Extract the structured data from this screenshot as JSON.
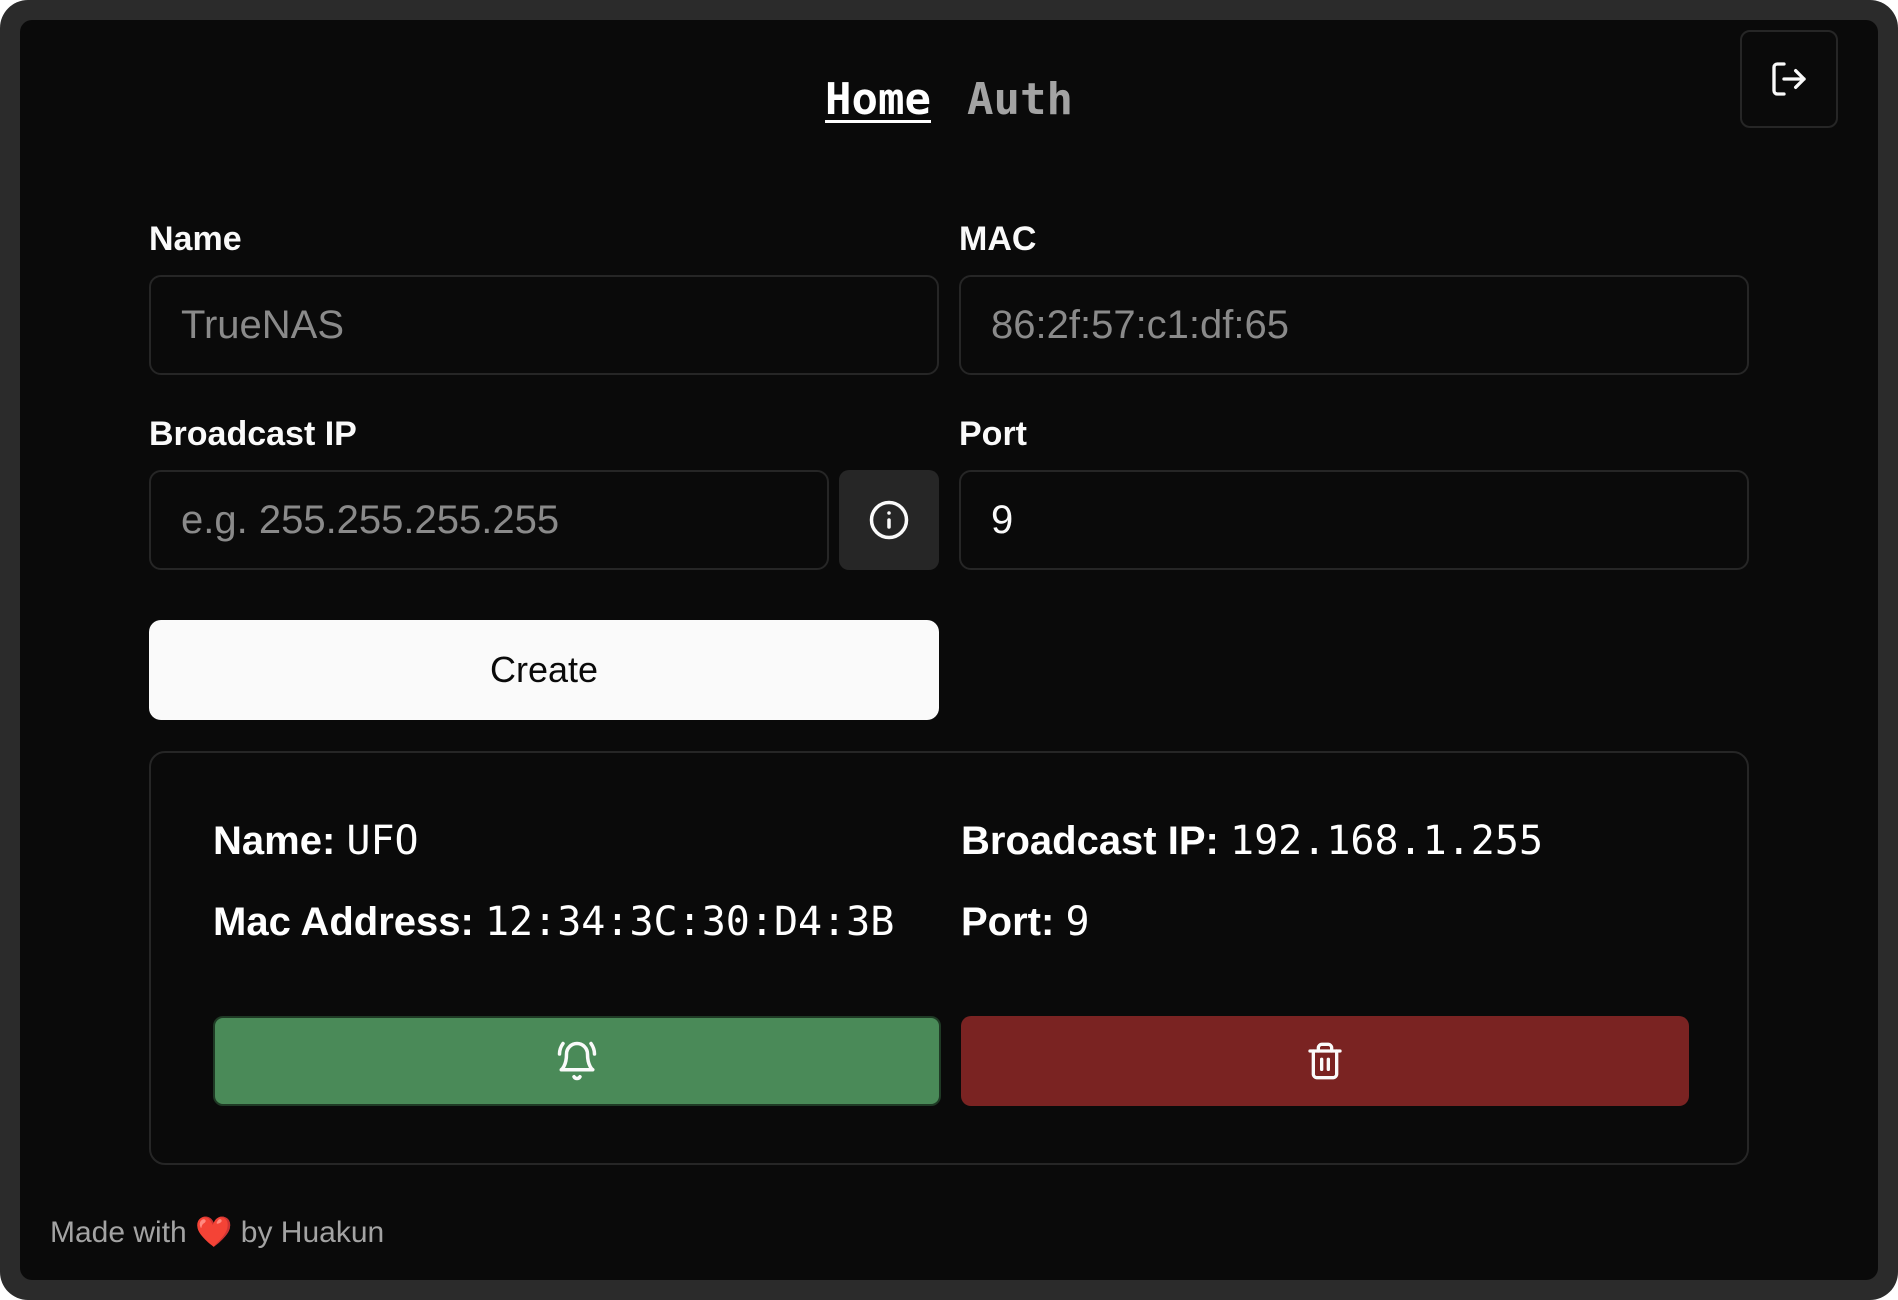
{
  "nav": {
    "home_label": "Home",
    "auth_label": "Auth",
    "logout_icon": "log-out-icon"
  },
  "form": {
    "name": {
      "label": "Name",
      "placeholder": "TrueNAS",
      "value": ""
    },
    "mac": {
      "label": "MAC",
      "placeholder": "86:2f:57:c1:df:65",
      "value": ""
    },
    "broadcast_ip": {
      "label": "Broadcast IP",
      "placeholder": "e.g. 255.255.255.255",
      "value": "",
      "info_icon": "info-icon"
    },
    "port": {
      "label": "Port",
      "placeholder": "",
      "value": "9"
    },
    "create_label": "Create"
  },
  "device": {
    "name_key": "Name:",
    "name_value": "UFO",
    "mac_key": "Mac Address:",
    "mac_value": "12:34:3C:30:D4:3B",
    "broadcast_key": "Broadcast IP:",
    "broadcast_value": "192.168.1.255",
    "port_key": "Port:",
    "port_value": "9",
    "wake_icon": "bell-ring-icon",
    "delete_icon": "trash-icon"
  },
  "colors": {
    "background": "#0a0a0a",
    "wake_button": "#4a8a58",
    "delete_button": "#7a2322",
    "primary_button": "#fafafa"
  },
  "footer": {
    "prefix": "Made with",
    "heart": "❤️",
    "suffix": "by Huakun"
  }
}
